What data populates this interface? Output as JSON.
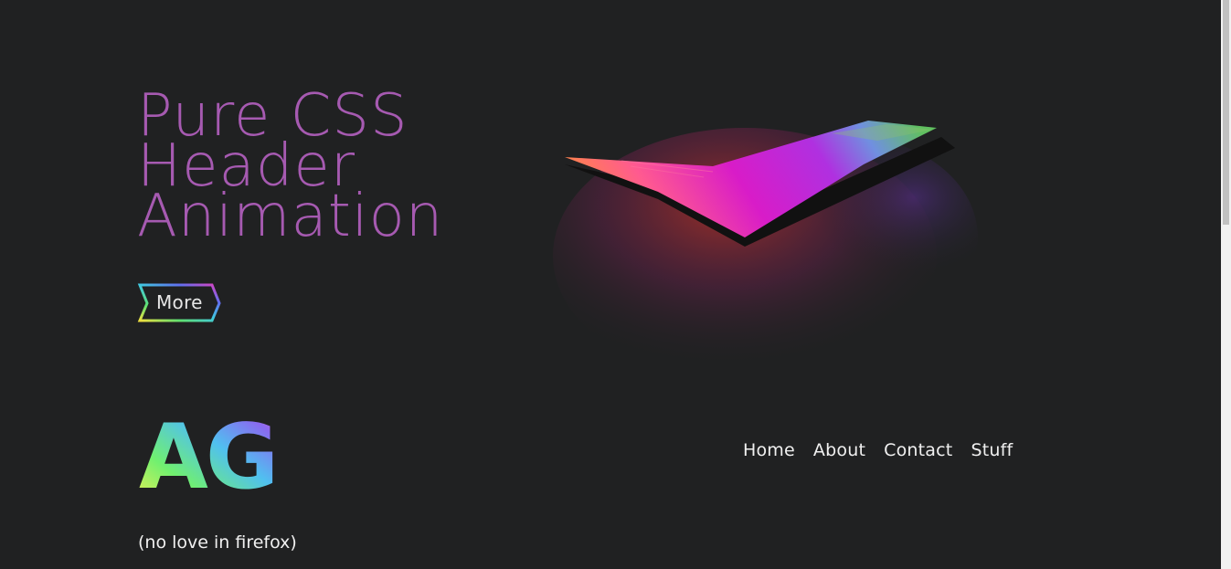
{
  "hero": {
    "title_line1": "Pure CSS",
    "title_line2": "Header",
    "title_line3": "Animation",
    "title_color": "#a65ab1",
    "more_label": "More"
  },
  "logo": {
    "text": "AG"
  },
  "nav": {
    "items": [
      {
        "label": "Home"
      },
      {
        "label": "About"
      },
      {
        "label": "Contact"
      },
      {
        "label": "Stuff"
      }
    ]
  },
  "footnote": "(no love in firefox)",
  "colors": {
    "background": "#202122",
    "text": "#f0f0f0",
    "accent": "#a65ab1"
  }
}
